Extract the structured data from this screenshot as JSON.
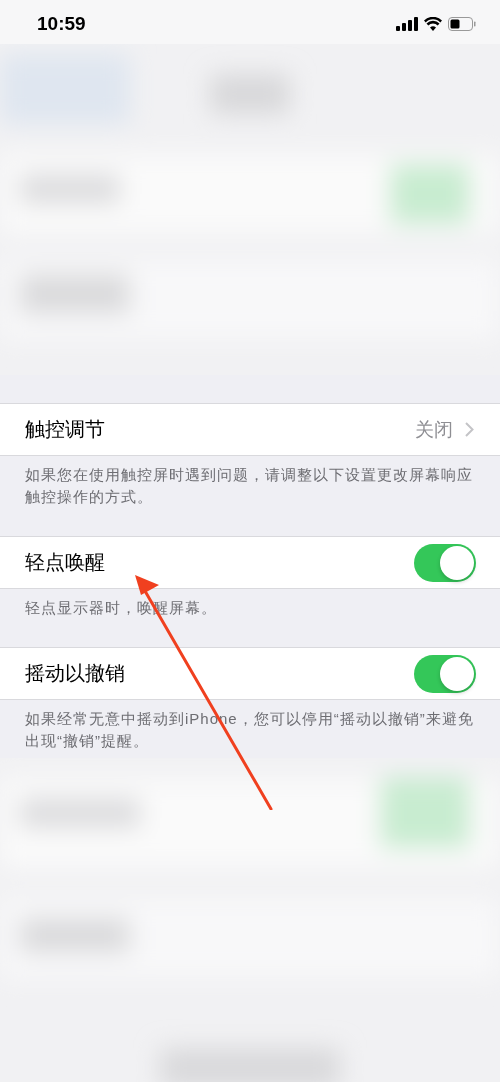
{
  "status_bar": {
    "time": "10:59"
  },
  "sections": [
    {
      "kind": "disclosure",
      "label": "触控调节",
      "value": "关闭",
      "footer": "如果您在使用触控屏时遇到问题，请调整以下设置更改屏幕响应触控操作的方式。"
    },
    {
      "kind": "toggle",
      "label": "轻点唤醒",
      "on": true,
      "footer": "轻点显示器时，唤醒屏幕。"
    },
    {
      "kind": "toggle",
      "label": "摇动以撤销",
      "on": true,
      "footer": "如果经常无意中摇动到iPhone，您可以停用“摇动以撤销”来避免出现“撤销”提醒。"
    }
  ]
}
